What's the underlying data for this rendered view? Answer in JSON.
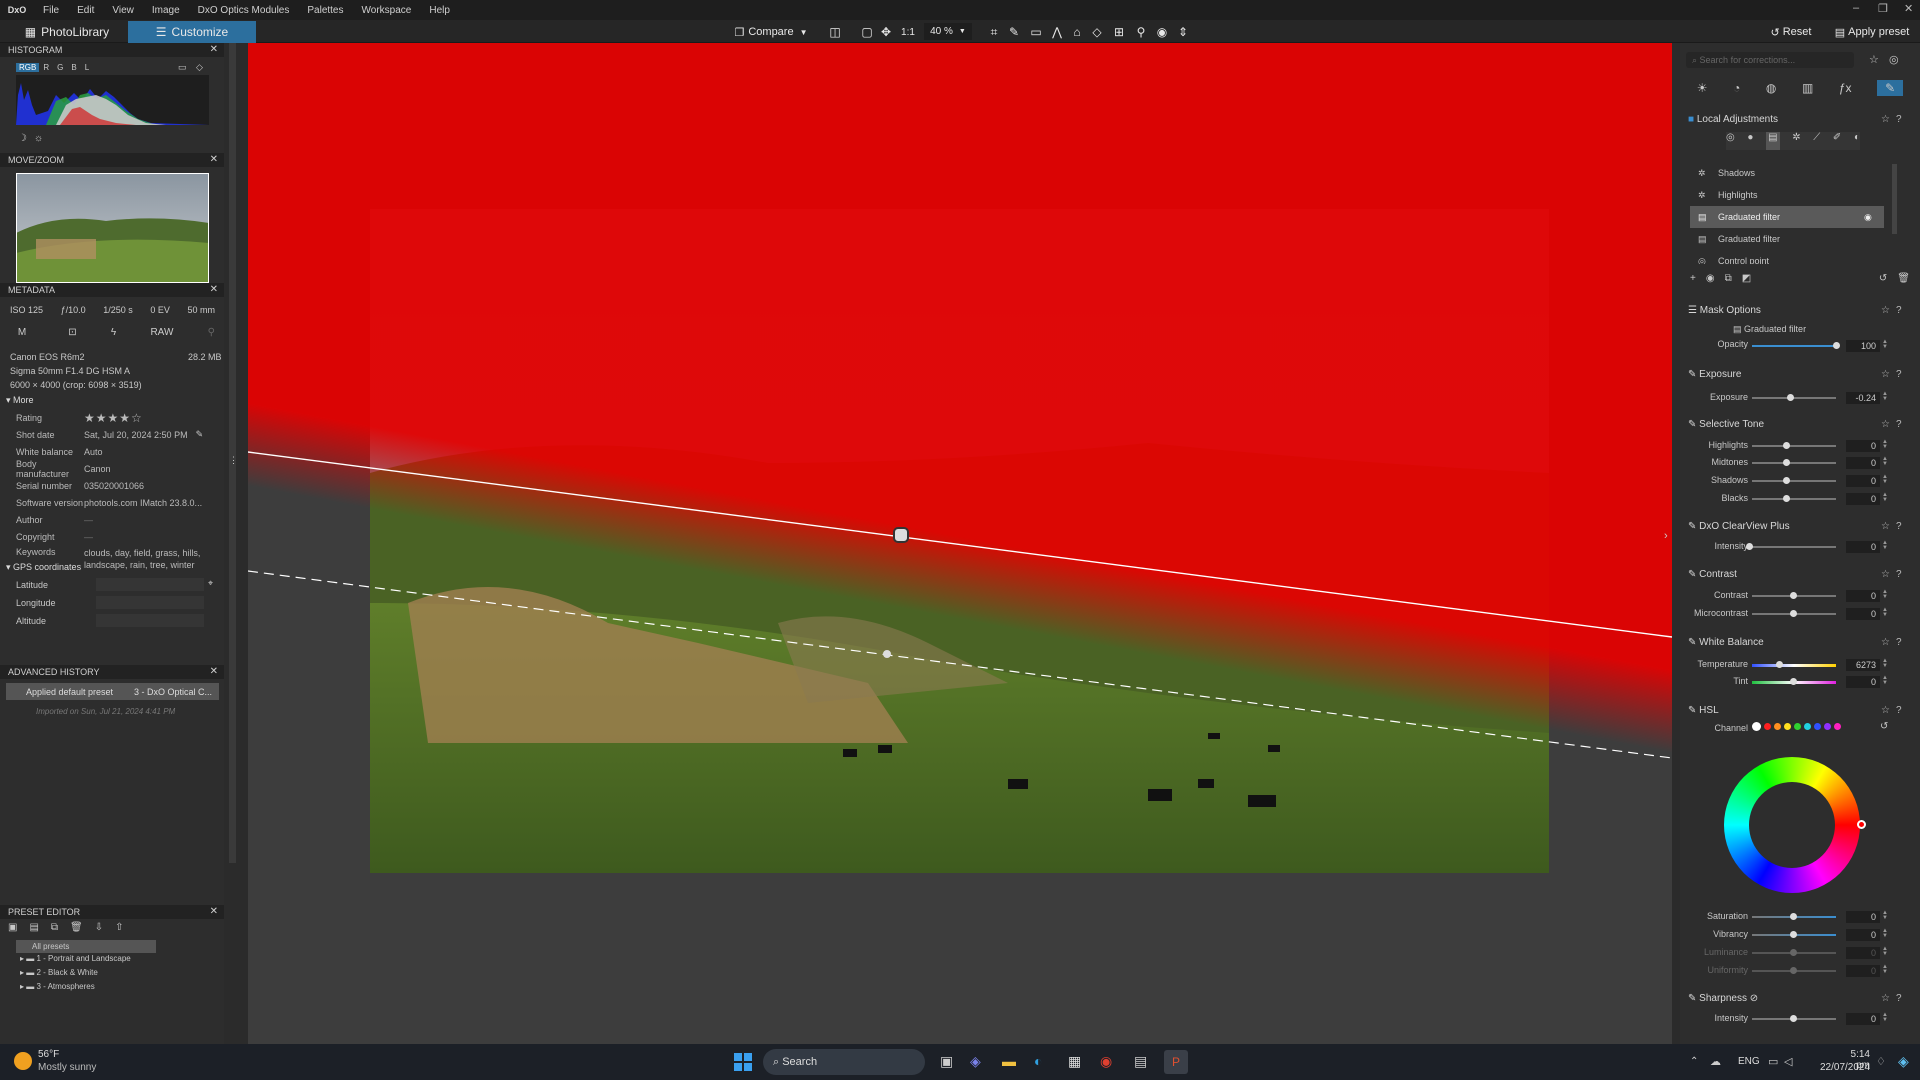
{
  "app": {
    "logo": "DxO",
    "menu": [
      "File",
      "Edit",
      "View",
      "Image",
      "DxO Optics Modules",
      "Palettes",
      "Workspace",
      "Help"
    ],
    "window_controls": [
      "–",
      "❐",
      "✕"
    ]
  },
  "toolbar": {
    "photolibrary": "PhotoLibrary",
    "customize": "Customize",
    "compare": "Compare",
    "ratio": "1:1",
    "zoom": "40 %",
    "reset": "Reset",
    "apply_preset": "Apply preset"
  },
  "histogram": {
    "title": "HISTOGRAM",
    "channels": [
      "RGB",
      "R",
      "G",
      "B",
      "L"
    ]
  },
  "movezoom": {
    "title": "MOVE/ZOOM"
  },
  "metadata": {
    "title": "METADATA",
    "iso": "ISO 125",
    "aperture": "ƒ/10.0",
    "shutter": "1/250 s",
    "ev": "0 EV",
    "focal": "50 mm",
    "mode": "M",
    "format": "RAW",
    "camera": "Canon EOS R6m2",
    "size": "28.2 MB",
    "lens": "Sigma 50mm F1.4 DG HSM A",
    "dims": "6000 × 4000 (crop: 6098 × 3519)",
    "more": "More",
    "rows": [
      {
        "k": "Rating",
        "v": "★★★★☆"
      },
      {
        "k": "Shot date",
        "v": "Sat, Jul 20, 2024 2:50 PM"
      },
      {
        "k": "White balance",
        "v": "Auto"
      },
      {
        "k": "Body manufacturer",
        "v": "Canon"
      },
      {
        "k": "Serial number",
        "v": "035020001066"
      },
      {
        "k": "Software version",
        "v": "photools.com IMatch 23.8.0..."
      },
      {
        "k": "Author",
        "v": "—"
      },
      {
        "k": "Copyright",
        "v": "—"
      },
      {
        "k": "Keywords",
        "v": "clouds, day, field, grass, hills, landscape, rain, tree, winter"
      }
    ],
    "gps": "GPS coordinates",
    "gps_rows": [
      "Latitude",
      "Longitude",
      "Altitude"
    ]
  },
  "history": {
    "title": "ADVANCED HISTORY",
    "item": "Applied default preset",
    "item2": "3 - DxO Optical C...",
    "imported": "Imported on Sun, Jul 21, 2024 4:41 PM"
  },
  "presets": {
    "title": "PRESET EDITOR",
    "items": [
      "All presets",
      "1 - Portrait and Landscape",
      "2 - Black & White",
      "3 - Atmospheres"
    ]
  },
  "right": {
    "search_placeholder": "Search for corrections...",
    "local_adj": "Local Adjustments",
    "list": [
      "Shadows",
      "Highlights",
      "Graduated filter",
      "Graduated filter",
      "Control point"
    ],
    "mask_options": "Mask Options",
    "mask_type": "Graduated filter",
    "opacity_label": "Opacity",
    "opacity": "100",
    "exposure_title": "Exposure",
    "exposure_label": "Exposure",
    "exposure": "-0.24",
    "tone_title": "Selective Tone",
    "tone": [
      {
        "k": "Highlights",
        "v": "0"
      },
      {
        "k": "Midtones",
        "v": "0"
      },
      {
        "k": "Shadows",
        "v": "0"
      },
      {
        "k": "Blacks",
        "v": "0"
      }
    ],
    "clearview_title": "DxO ClearView Plus",
    "intensity_label": "Intensity",
    "intensity": "0",
    "contrast_title": "Contrast",
    "contrast": [
      {
        "k": "Contrast",
        "v": "0"
      },
      {
        "k": "Microcontrast",
        "v": "0"
      }
    ],
    "wb_title": "White Balance",
    "temp_label": "Temperature",
    "temp": "6273",
    "tint_label": "Tint",
    "tint": "0",
    "hsl_title": "HSL",
    "channel_label": "Channel",
    "hsl": [
      {
        "k": "Saturation",
        "v": "0"
      },
      {
        "k": "Vibrancy",
        "v": "0"
      },
      {
        "k": "Luminance",
        "v": "0"
      },
      {
        "k": "Uniformity",
        "v": "0"
      }
    ],
    "sharp_title": "Sharpness",
    "sharp_label": "Intensity",
    "sharp": "0"
  },
  "taskbar": {
    "temp": "56°F",
    "weather": "Mostly sunny",
    "search": "Search",
    "lang": "ENG",
    "time": "5:14 pm",
    "date": "22/07/2024"
  }
}
